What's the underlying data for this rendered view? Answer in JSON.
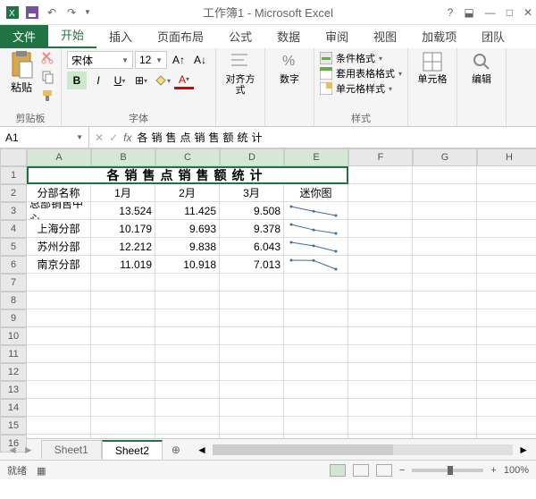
{
  "titlebar": {
    "title": "工作簿1 - Microsoft Excel"
  },
  "tabs": {
    "file": "文件",
    "home": "开始",
    "insert": "插入",
    "layout": "页面布局",
    "formula": "公式",
    "data": "数据",
    "review": "审阅",
    "view": "视图",
    "addin": "加载项",
    "team": "团队"
  },
  "ribbon": {
    "clipboard": {
      "paste": "粘贴",
      "label": "剪贴板"
    },
    "font": {
      "name": "宋体",
      "size": "12",
      "label": "字体"
    },
    "align": {
      "label": "对齐方式"
    },
    "number": {
      "label": "数字"
    },
    "styles": {
      "cond": "条件格式",
      "table": "套用表格格式",
      "cell": "单元格样式",
      "label": "样式"
    },
    "cells": {
      "label": "单元格"
    },
    "edit": {
      "label": "编辑"
    }
  },
  "formula": {
    "name_box": "A1",
    "value": "各销售点销售额统计"
  },
  "grid": {
    "cols": [
      "A",
      "B",
      "C",
      "D",
      "E",
      "F",
      "G",
      "H"
    ],
    "rows": [
      "1",
      "2",
      "3",
      "4",
      "5",
      "6",
      "7",
      "8",
      "9",
      "10",
      "11",
      "12",
      "13",
      "14",
      "15",
      "16"
    ],
    "title": "各销售点销售额统计",
    "headers": {
      "name": "分部名称",
      "m1": "1月",
      "m2": "2月",
      "m3": "3月",
      "spark": "迷你图"
    },
    "data": [
      {
        "name": "总部销售中心",
        "m1": "13.524",
        "m2": "11.425",
        "m3": "9.508"
      },
      {
        "name": "上海分部",
        "m1": "10.179",
        "m2": "9.693",
        "m3": "9.378"
      },
      {
        "name": "苏州分部",
        "m1": "12.212",
        "m2": "9.838",
        "m3": "6.043"
      },
      {
        "name": "南京分部",
        "m1": "11.019",
        "m2": "10.918",
        "m3": "7.013"
      }
    ]
  },
  "sheets": {
    "s1": "Sheet1",
    "s2": "Sheet2"
  },
  "status": {
    "ready": "就绪",
    "zoom": "100%"
  },
  "chart_data": [
    {
      "type": "line",
      "x": [
        "1月",
        "2月",
        "3月"
      ],
      "values": [
        13.524,
        11.425,
        9.508
      ],
      "title": "总部销售中心"
    },
    {
      "type": "line",
      "x": [
        "1月",
        "2月",
        "3月"
      ],
      "values": [
        10.179,
        9.693,
        9.378
      ],
      "title": "上海分部"
    },
    {
      "type": "line",
      "x": [
        "1月",
        "2月",
        "3月"
      ],
      "values": [
        12.212,
        9.838,
        6.043
      ],
      "title": "苏州分部"
    },
    {
      "type": "line",
      "x": [
        "1月",
        "2月",
        "3月"
      ],
      "values": [
        11.019,
        10.918,
        7.013
      ],
      "title": "南京分部"
    }
  ]
}
